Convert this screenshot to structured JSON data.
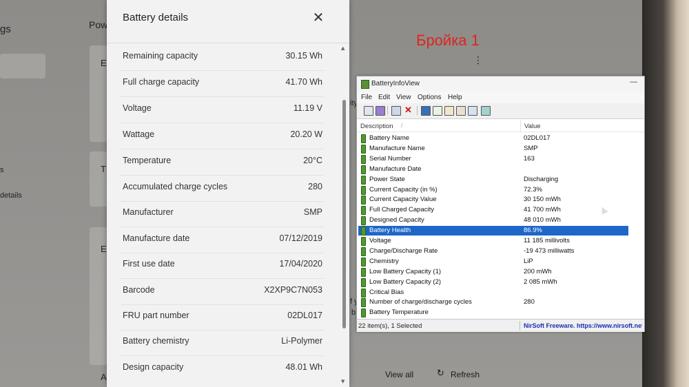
{
  "background": {
    "left_fragments": [
      "gs",
      "s",
      "details"
    ],
    "section_heading": "Pow",
    "partial_letters": [
      "E",
      "T",
      "E",
      "f y",
      "b",
      "A",
      "ity"
    ],
    "overlay_label": "Бройка 1",
    "view_all_label": "View all",
    "refresh_label": "Refresh"
  },
  "battery_panel": {
    "title": "Battery details",
    "close_icon": "close-icon",
    "rows": [
      {
        "label": "Remaining capacity",
        "value": "30.15 Wh"
      },
      {
        "label": "Full charge capacity",
        "value": "41.70 Wh"
      },
      {
        "label": "Voltage",
        "value": "11.19 V"
      },
      {
        "label": "Wattage",
        "value": "20.20 W"
      },
      {
        "label": "Temperature",
        "value": "20°C"
      },
      {
        "label": "Accumulated charge cycles",
        "value": "280"
      },
      {
        "label": "Manufacturer",
        "value": "SMP"
      },
      {
        "label": "Manufacture date",
        "value": "07/12/2019"
      },
      {
        "label": "First use date",
        "value": "17/04/2020"
      },
      {
        "label": "Barcode",
        "value": "X2XP9C7N053"
      },
      {
        "label": "FRU part number",
        "value": "02DL017"
      },
      {
        "label": "Battery chemistry",
        "value": "Li-Polymer"
      },
      {
        "label": "Design capacity",
        "value": "48.01 Wh"
      }
    ]
  },
  "battery_info_view": {
    "title": "BatteryInfoView",
    "menu": [
      "File",
      "Edit",
      "View",
      "Options",
      "Help"
    ],
    "columns": {
      "description": "Description",
      "value": "Value",
      "sort_glyph": "/"
    },
    "rows": [
      {
        "d": "Battery Name",
        "v": "02DL017",
        "selected": false
      },
      {
        "d": "Manufacture Name",
        "v": "SMP",
        "selected": false
      },
      {
        "d": "Serial Number",
        "v": "163",
        "selected": false
      },
      {
        "d": "Manufacture Date",
        "v": "",
        "selected": false
      },
      {
        "d": "Power State",
        "v": "Discharging",
        "selected": false
      },
      {
        "d": "Current Capacity (in %)",
        "v": "72.3%",
        "selected": false
      },
      {
        "d": "Current Capacity Value",
        "v": "30 150 mWh",
        "selected": false
      },
      {
        "d": "Full Charged Capacity",
        "v": "41 700 mWh",
        "selected": false
      },
      {
        "d": "Designed Capacity",
        "v": "48 010 mWh",
        "selected": false
      },
      {
        "d": "Battery Health",
        "v": "86.9%",
        "selected": true
      },
      {
        "d": "Voltage",
        "v": "11 185 millivolts",
        "selected": false
      },
      {
        "d": "Charge/Discharge Rate",
        "v": "-19 473 milliwatts",
        "selected": false
      },
      {
        "d": "Chemistry",
        "v": "LiP",
        "selected": false
      },
      {
        "d": "Low Battery Capacity (1)",
        "v": "200 mWh",
        "selected": false
      },
      {
        "d": "Low Battery Capacity (2)",
        "v": "2 085 mWh",
        "selected": false
      },
      {
        "d": "Critical Bias",
        "v": "",
        "selected": false
      },
      {
        "d": "Number of charge/discharge cycles",
        "v": "280",
        "selected": false
      },
      {
        "d": "Battery Temperature",
        "v": "",
        "selected": false
      }
    ],
    "status_left": "22 item(s), 1 Selected",
    "status_right": "NirSoft Freeware. https://www.nirsoft.net"
  },
  "colors": {
    "selection": "#1e66c8",
    "overlay_label": "#e0231f",
    "battery_icon": "#4f9a2f",
    "nirsoft_link": "#1a2fb0"
  }
}
